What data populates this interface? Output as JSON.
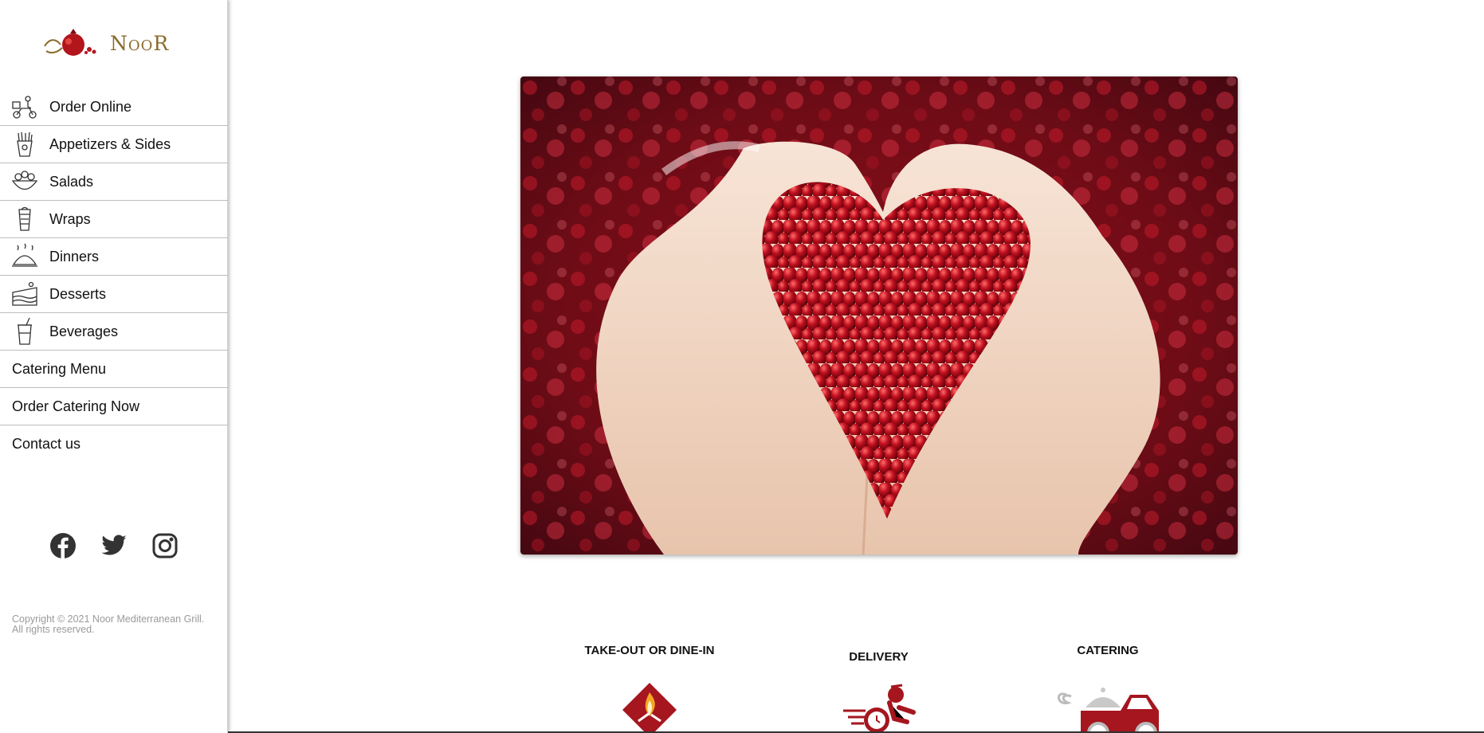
{
  "brand": {
    "logo_text": "NooR",
    "accent": "#b3151d"
  },
  "nav": {
    "items": [
      {
        "label": "Order Online",
        "icon": "scooter-icon"
      },
      {
        "label": "Appetizers & Sides",
        "icon": "fries-icon"
      },
      {
        "label": "Salads",
        "icon": "salad-bowl-icon"
      },
      {
        "label": "Wraps",
        "icon": "wrap-icon"
      },
      {
        "label": "Dinners",
        "icon": "cloche-icon"
      },
      {
        "label": "Desserts",
        "icon": "cake-icon"
      },
      {
        "label": "Beverages",
        "icon": "cup-icon"
      },
      {
        "label": "Catering Menu"
      },
      {
        "label": "Order Catering Now"
      },
      {
        "label": "Contact us"
      }
    ]
  },
  "social": [
    "facebook-icon",
    "twitter-icon",
    "instagram-icon"
  ],
  "copyright": {
    "line1": "Copyright © 2021 Noor Mediterranean Grill.",
    "line2": "All rights reserved."
  },
  "services": {
    "takeout": "TAKE-OUT OR DINE-IN",
    "delivery": "DELIVERY",
    "catering": "CATERING"
  }
}
